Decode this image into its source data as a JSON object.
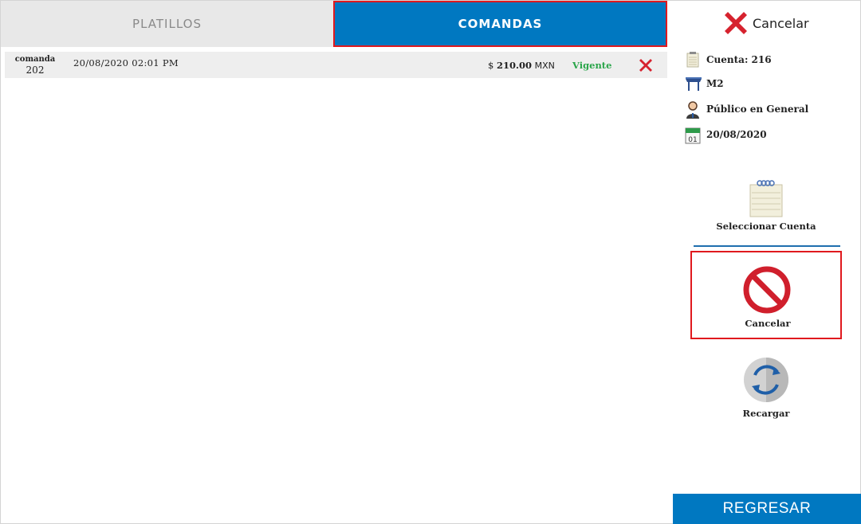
{
  "tabs": {
    "platillos": "PLATILLOS",
    "comandas": "COMANDAS",
    "active": "comandas"
  },
  "comandas": [
    {
      "label": "comanda",
      "number": "202",
      "datetime": "20/08/2020 02:01 PM",
      "price_prefix": "$",
      "amount": "210.00",
      "currency": "MXN",
      "status": "Vigente"
    }
  ],
  "panel": {
    "cancel_top_label": "Cancelar",
    "account": "Cuenta: 216",
    "table": "M2",
    "customer": "Público en General",
    "date": "20/08/2020",
    "select_account_label": "Seleccionar Cuenta",
    "cancel_label": "Cancelar",
    "reload_label": "Recargar"
  },
  "footer": {
    "back_label": "REGRESAR"
  },
  "colors": {
    "primary_blue": "#0078c1",
    "highlight_red": "#e0191e",
    "status_green": "#2aa54a",
    "tab_inactive_bg": "#e8e8e8",
    "row_bg": "#eeeeee"
  },
  "icons": {
    "top_cancel": "red-x-icon",
    "account": "notepad-icon",
    "table": "table-icon",
    "customer": "person-icon",
    "date": "calendar-icon",
    "select_account": "spiral-notepad-icon",
    "cancel": "prohibition-icon",
    "reload": "refresh-icon",
    "row_delete": "red-x-icon"
  }
}
